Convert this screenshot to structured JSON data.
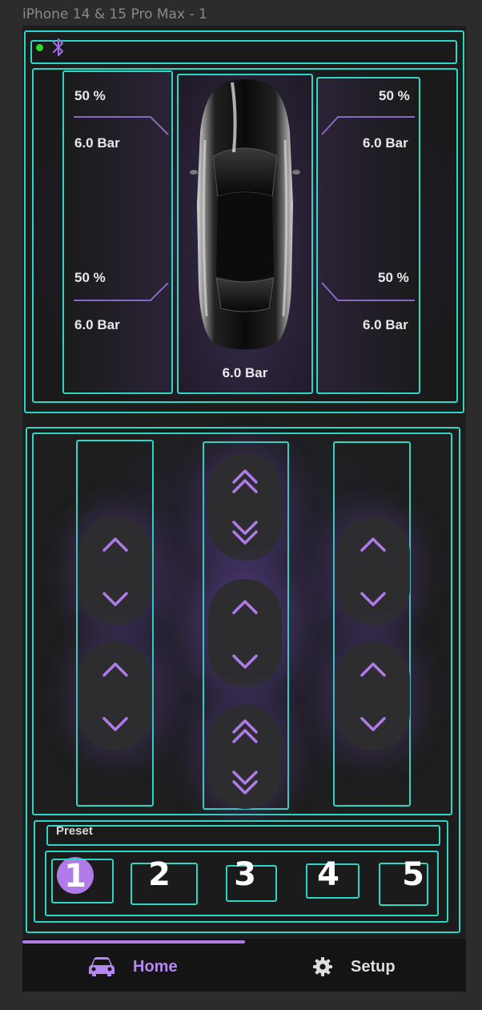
{
  "frame": {
    "title": "iPhone 14 & 15 Pro Max - 1"
  },
  "status": {
    "connection_icon": "bluetooth-icon",
    "indicator_color": "#2bdc2b"
  },
  "tires": {
    "front_left": {
      "percent": "50 %",
      "pressure": "6.0 Bar"
    },
    "rear_left": {
      "percent": "50 %",
      "pressure": "6.0 Bar"
    },
    "front_right": {
      "percent": "50 %",
      "pressure": "6.0 Bar"
    },
    "rear_right": {
      "percent": "50 %",
      "pressure": "6.0 Bar"
    },
    "tank": {
      "pressure": "6.0 Bar"
    }
  },
  "controls": {
    "left": [
      "chevron-up-icon",
      "chevron-down-icon",
      "chevron-up-icon",
      "chevron-down-icon"
    ],
    "center": [
      "double-chevron-up-icon",
      "double-chevron-down-icon",
      "chevron-up-icon",
      "chevron-down-icon",
      "double-chevron-up-icon",
      "double-chevron-down-icon"
    ],
    "right": [
      "chevron-up-icon",
      "chevron-down-icon",
      "chevron-up-icon",
      "chevron-down-icon"
    ]
  },
  "preset": {
    "label": "Preset",
    "items": [
      "1",
      "2",
      "3",
      "4",
      "5"
    ],
    "active": "1"
  },
  "nav": {
    "home_label": "Home",
    "setup_label": "Setup",
    "home_icon": "car-icon",
    "setup_icon": "gear-icon",
    "active": "Home"
  },
  "colors": {
    "accent": "#b07ae8",
    "outline": "#2fd6c4",
    "background": "#1e1e1e"
  }
}
